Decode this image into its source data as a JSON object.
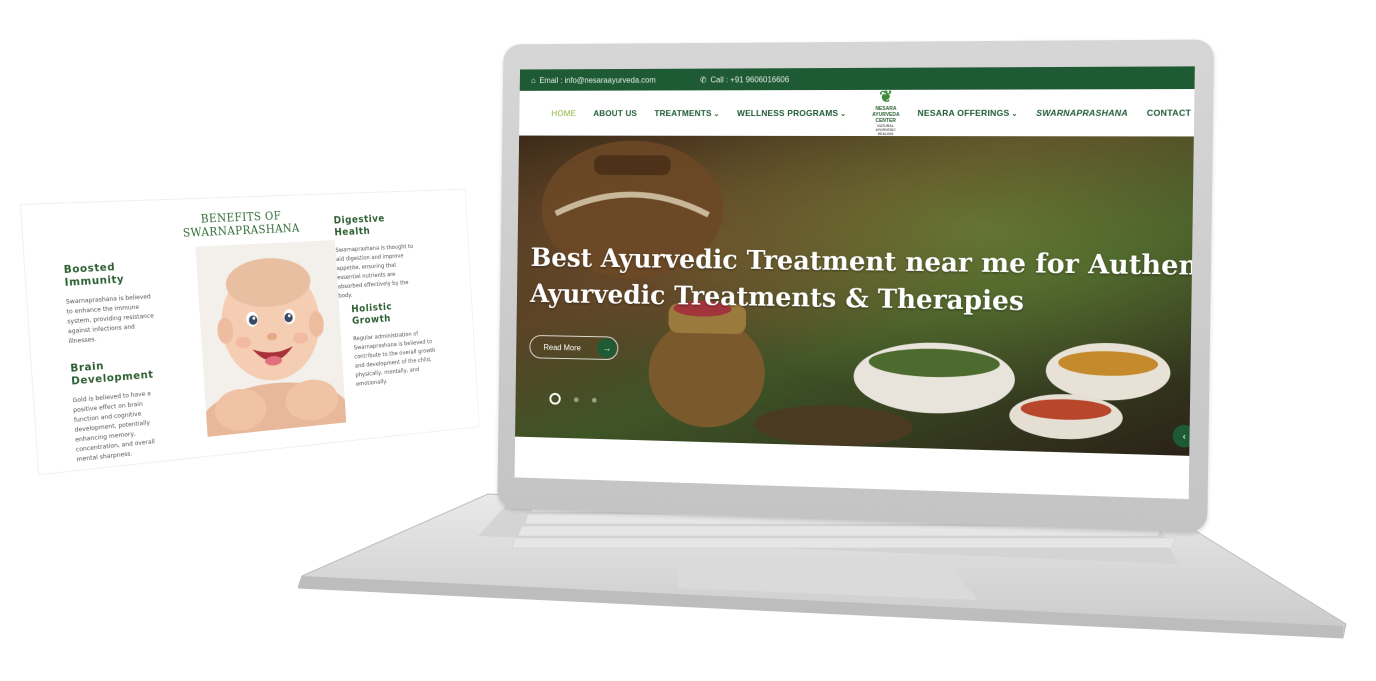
{
  "card": {
    "title": "BENEFITS OF SWARNAPRASHANA",
    "blocks": [
      {
        "heading": "Boosted Immunity",
        "text": "Swarnaprashana is believed to enhance the immune system, providing resistance against infections and illnesses."
      },
      {
        "heading": "Brain Development",
        "text": "Gold is believed to have a positive effect on brain function and cognitive development, potentially enhancing memory, concentration, and overall mental sharpness."
      },
      {
        "heading": "Digestive Health",
        "text": "Swarnaprashana is thought to aid digestion and improve appetite, ensuring that essential nutrients are absorbed effectively by the body."
      },
      {
        "heading": "Holistic Growth",
        "text": "Regular administration of Swarnaprashana is believed to contribute to the overall growth and development of the child, physically, mentally, and emotionally."
      }
    ]
  },
  "site": {
    "topbar": {
      "email": "Email : info@nesaraayurveda.com",
      "call": "Call : +91 9606016606"
    },
    "nav": {
      "home": "HOME",
      "about": "ABOUT US",
      "treatments": "TREATMENTS",
      "wellness": "WELLNESS PROGRAMS",
      "offerings": "NESARA OFFERINGS",
      "swarnaprashana": "SWARNAPRASHANA",
      "contact": "CONTACT US",
      "caret": "⌄"
    },
    "logo": {
      "name": "NESARA AYURVEDA CENTER",
      "tagline": "NATURAL AYURVEDIC HEALING"
    },
    "hero": {
      "title_line1": "Best Ayurvedic Treatment near me for Authentic",
      "title_line2": "Ayurvedic Treatments & Therapies",
      "button_label": "Read More",
      "button_arrow": "→",
      "next_arrow": "‹"
    }
  },
  "colors": {
    "brand_green": "#1e5a34",
    "accent_green": "#8cb33a",
    "laptop_silver": "#c8c8c8"
  },
  "icons": [
    "home-icon",
    "phone-icon",
    "arrow-right-icon",
    "chevron-left-icon"
  ]
}
